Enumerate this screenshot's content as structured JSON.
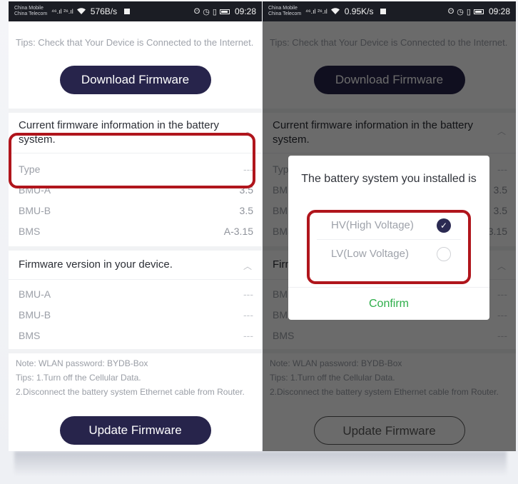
{
  "statusbar": {
    "carrier1": "China Mobile",
    "carrier2": "China Telecom",
    "signal": "⁴⁶.ıl ²⁶.ıl",
    "left_speed": "576B/s",
    "right_speed": "0.95K/s",
    "time": "09:28"
  },
  "page": {
    "tips_internet": "Tips: Check that Your Device is Connected to the Internet.",
    "download_label": "Download Firmware",
    "battery_section_title": "Current firmware information in the battery system.",
    "battery_rows": [
      {
        "label": "Type",
        "value": "---"
      },
      {
        "label": "BMU-A",
        "value": "3.5"
      },
      {
        "label": "BMU-B",
        "value": "3.5"
      },
      {
        "label": "BMS",
        "value": "A-3.15"
      }
    ],
    "device_section_title": "Firmware version in your device.",
    "device_rows": [
      {
        "label": "BMU-A",
        "value": "---"
      },
      {
        "label": "BMU-B",
        "value": "---"
      },
      {
        "label": "BMS",
        "value": "---"
      }
    ],
    "note_password": "Note: WLAN password: BYDB-Box",
    "note_tip1": "Tips: 1.Turn off the Cellular Data.",
    "note_tip2": "2.Disconnect the battery system Ethernet cable from Router.",
    "update_label": "Update Firmware"
  },
  "dialog": {
    "title": "The battery system you installed is",
    "option_hv": "HV(High Voltage)",
    "option_lv": "LV(Low Voltage)",
    "selected": "HV(High Voltage)",
    "confirm_label": "Confirm"
  },
  "colors": {
    "button_bg": "#27244b",
    "highlight": "#b0151c",
    "confirm": "#2eae4a"
  },
  "icons": {
    "chevron": "chevron-up-icon",
    "check": "check-icon",
    "wifi": "wifi-icon",
    "alarm": "alarm-icon",
    "battery": "battery-icon"
  }
}
